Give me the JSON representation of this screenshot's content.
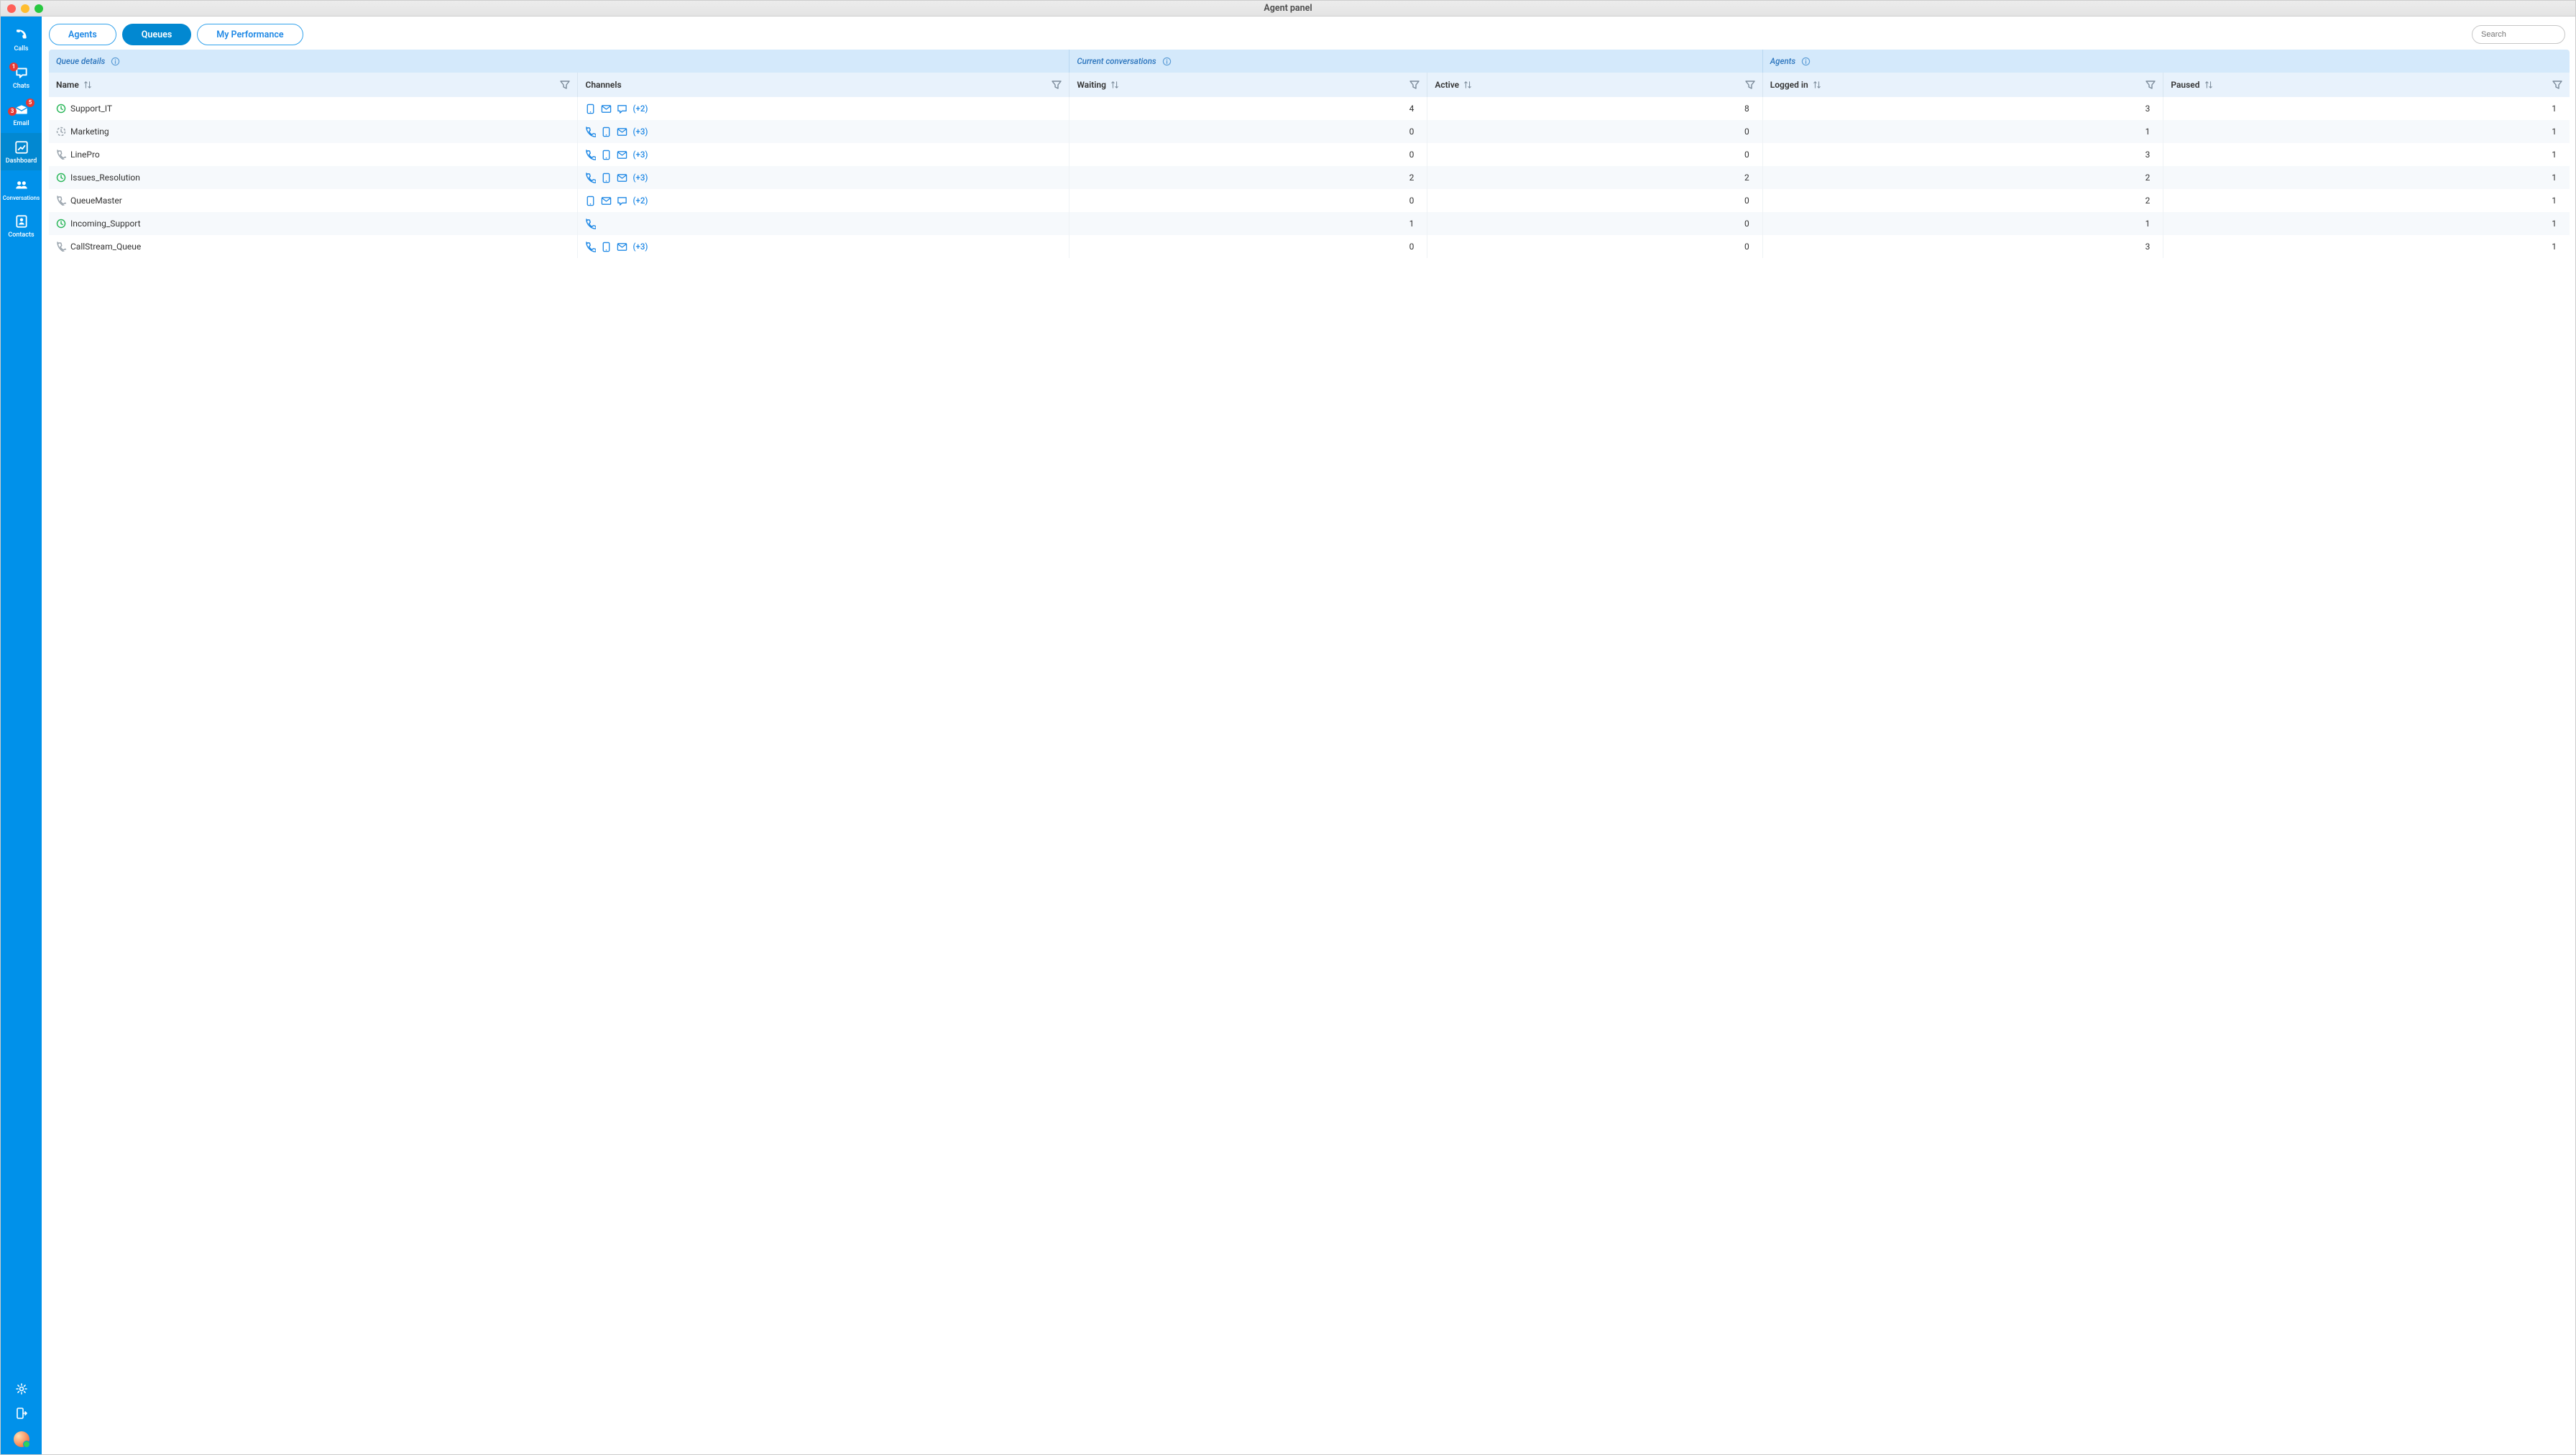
{
  "window": {
    "title": "Agent panel"
  },
  "sidebar": {
    "items": [
      {
        "key": "calls",
        "label": "Calls",
        "badge": null,
        "icon": "phone-icon"
      },
      {
        "key": "chats",
        "label": "Chats",
        "badge": "1",
        "icon": "chat-icon"
      },
      {
        "key": "email",
        "label": "Email",
        "badge": "5",
        "badge2": "3",
        "icon": "email-icon"
      },
      {
        "key": "dashboard",
        "label": "Dashboard",
        "badge": null,
        "icon": "dashboard-icon",
        "active": true
      },
      {
        "key": "conversations",
        "label": "Conversations",
        "badge": null,
        "icon": "group-icon"
      },
      {
        "key": "contacts",
        "label": "Contacts",
        "badge": null,
        "icon": "contact-icon"
      }
    ]
  },
  "toolbar": {
    "tabs": [
      {
        "key": "agents",
        "label": "Agents"
      },
      {
        "key": "queues",
        "label": "Queues",
        "active": true
      },
      {
        "key": "myperf",
        "label": "My Performance"
      }
    ],
    "search": {
      "placeholder": "Search"
    }
  },
  "sections": {
    "queue_details": "Queue details",
    "current_conversations": "Current conversations",
    "agents": "Agents"
  },
  "columns": {
    "name": "Name",
    "channels": "Channels",
    "waiting": "Waiting",
    "active": "Active",
    "logged_in": "Logged in",
    "paused": "Paused"
  },
  "rows": [
    {
      "name": "Support_IT",
      "status_icon": "clock-green",
      "channels": [
        "mobile",
        "mail",
        "chat"
      ],
      "more": "(+2)",
      "waiting": 4,
      "active": 8,
      "logged_in": 3,
      "paused": 1
    },
    {
      "name": "Marketing",
      "status_icon": "clock-grey-dashed",
      "channels": [
        "phone",
        "mobile",
        "mail"
      ],
      "more": "(+3)",
      "waiting": 0,
      "active": 0,
      "logged_in": 1,
      "paused": 1
    },
    {
      "name": "LinePro",
      "status_icon": "phone-grey",
      "channels": [
        "phone",
        "mobile",
        "mail"
      ],
      "more": "(+3)",
      "waiting": 0,
      "active": 0,
      "logged_in": 3,
      "paused": 1
    },
    {
      "name": "Issues_Resolution",
      "status_icon": "clock-green",
      "channels": [
        "phone",
        "mobile",
        "mail"
      ],
      "more": "(+3)",
      "waiting": 2,
      "active": 2,
      "logged_in": 2,
      "paused": 1
    },
    {
      "name": "QueueMaster",
      "status_icon": "phone-grey",
      "channels": [
        "mobile",
        "mail",
        "chat"
      ],
      "more": "(+2)",
      "waiting": 0,
      "active": 0,
      "logged_in": 2,
      "paused": 1
    },
    {
      "name": "Incoming_Support",
      "status_icon": "clock-green",
      "channels": [
        "phone"
      ],
      "more": "",
      "waiting": 1,
      "active": 0,
      "logged_in": 1,
      "paused": 1
    },
    {
      "name": "CallStream_Queue",
      "status_icon": "phone-grey",
      "channels": [
        "phone",
        "mobile",
        "mail"
      ],
      "more": "(+3)",
      "waiting": 0,
      "active": 0,
      "logged_in": 3,
      "paused": 1
    }
  ]
}
